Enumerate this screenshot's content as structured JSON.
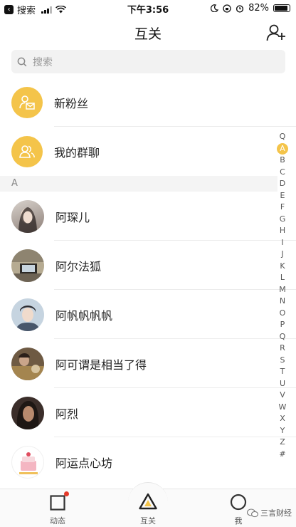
{
  "status_bar": {
    "back_app": "搜索",
    "time": "下午3:56",
    "battery": "82%"
  },
  "header": {
    "title": "互关"
  },
  "search": {
    "placeholder": "搜索"
  },
  "fixed_items": [
    {
      "label": "新粉丝",
      "icon": "new-fans-icon"
    },
    {
      "label": "我的群聊",
      "icon": "group-chat-icon"
    }
  ],
  "section": {
    "header": "A"
  },
  "contacts": [
    {
      "name": "阿琛儿"
    },
    {
      "name": "阿尔法狐"
    },
    {
      "name": "阿帆帆帆帆"
    },
    {
      "name": "阿可谓是相当了得"
    },
    {
      "name": "阿烈"
    },
    {
      "name": "阿运点心坊"
    }
  ],
  "index_letters": [
    "Q",
    "A",
    "B",
    "C",
    "D",
    "E",
    "F",
    "G",
    "H",
    "I",
    "J",
    "K",
    "L",
    "M",
    "N",
    "O",
    "P",
    "Q",
    "R",
    "S",
    "T",
    "U",
    "V",
    "W",
    "X",
    "Y",
    "Z",
    "#"
  ],
  "index_active": "A",
  "tabs": [
    {
      "label": "动态",
      "icon": "square-icon"
    },
    {
      "label": "互关",
      "icon": "triangle-icon"
    },
    {
      "label": "我",
      "icon": "circle-icon"
    }
  ],
  "watermark": "三言财经",
  "colors": {
    "accent": "#f4c44a",
    "badge": "#e53a2a"
  }
}
